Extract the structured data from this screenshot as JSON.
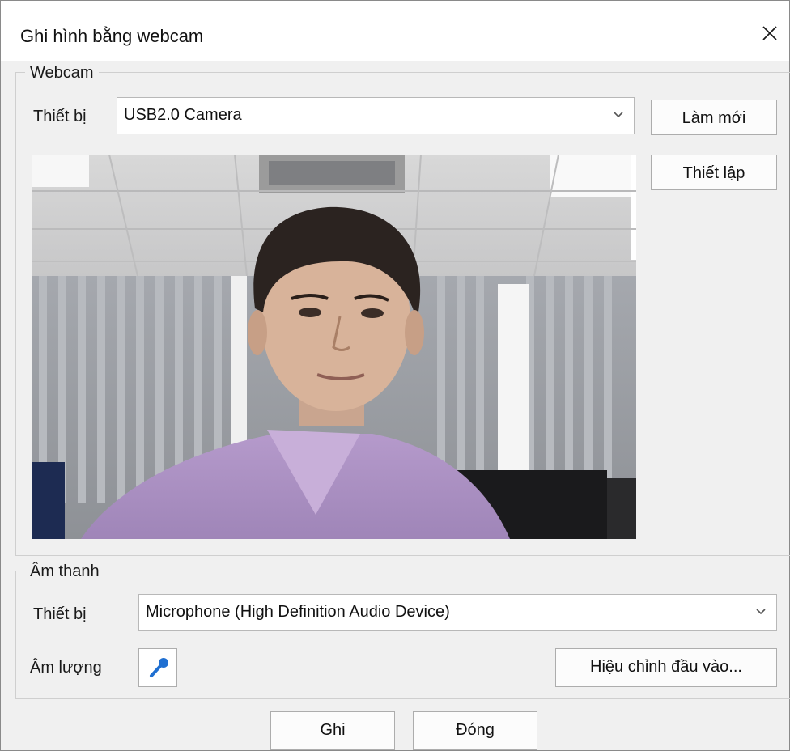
{
  "window": {
    "title": "Ghi hình bằng webcam",
    "close_icon": "close-icon"
  },
  "webcam_group": {
    "label": "Webcam",
    "device_label": "Thiết bị",
    "device_value": "USB2.0 Camera",
    "refresh_button": "Làm mới",
    "settings_button": "Thiết lập",
    "preview": "webcam-preview-image"
  },
  "audio_group": {
    "label": "Âm thanh",
    "device_label": "Thiết bị",
    "device_value": "Microphone (High Definition Audio Device)",
    "volume_label": "Âm lượng",
    "microphone_icon": "microphone-icon",
    "adjust_button": "Hiệu chỉnh đầu vào..."
  },
  "footer": {
    "record_button": "Ghi",
    "close_button": "Đóng"
  },
  "colors": {
    "dialog_background": "#f0f0f0",
    "titlebar_background": "#ffffff",
    "button_border": "#adadad",
    "microphone_blue": "#1f6fd1"
  }
}
